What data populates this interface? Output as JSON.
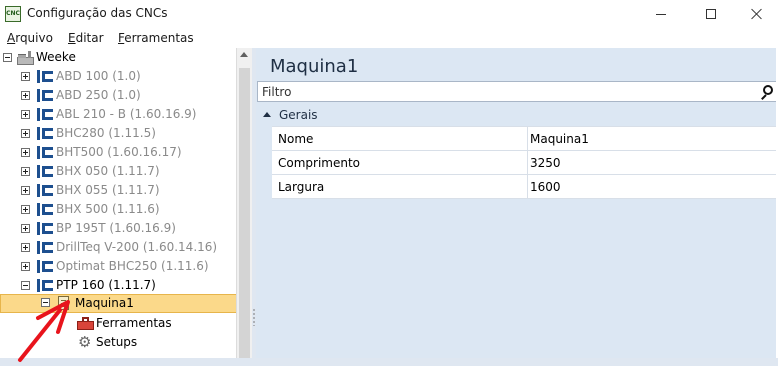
{
  "window": {
    "title": "Configuração das CNCs",
    "app_icon_text": "CNC"
  },
  "menu": {
    "items": [
      "Arquivo",
      "Editar",
      "Ferramentas"
    ]
  },
  "tree": {
    "root": {
      "label": "Weeke",
      "icon": "factory-icon",
      "expanded": true
    },
    "machines": [
      {
        "label": "ABD 100 (1.0)",
        "expanded": false,
        "disabled": true
      },
      {
        "label": "ABD 250 (1.0)",
        "expanded": false,
        "disabled": true
      },
      {
        "label": "ABL 210 - B (1.60.16.9)",
        "expanded": false,
        "disabled": true
      },
      {
        "label": "BHC280 (1.11.5)",
        "expanded": false,
        "disabled": true
      },
      {
        "label": "BHT500 (1.60.16.17)",
        "expanded": false,
        "disabled": true
      },
      {
        "label": "BHX 050 (1.11.7)",
        "expanded": false,
        "disabled": true
      },
      {
        "label": "BHX 055 (1.11.7)",
        "expanded": false,
        "disabled": true
      },
      {
        "label": "BHX 500 (1.11.6)",
        "expanded": false,
        "disabled": true
      },
      {
        "label": "BP 195T (1.60.16.9)",
        "expanded": false,
        "disabled": true
      },
      {
        "label": "DrillTeq V-200 (1.60.14.16)",
        "expanded": false,
        "disabled": true
      },
      {
        "label": "Optimat BHC250 (1.11.6)",
        "expanded": false,
        "disabled": true
      },
      {
        "label": "PTP 160 (1.11.7)",
        "expanded": true,
        "disabled": false
      }
    ],
    "selected": {
      "label": "Maquina1",
      "expanded": true
    },
    "children": [
      {
        "label": "Ferramentas",
        "icon": "toolbox-icon"
      },
      {
        "label": "Setups",
        "icon": "gear-icon"
      }
    ]
  },
  "properties": {
    "title": "Maquina1",
    "filter_placeholder": "Filtro",
    "group": "Gerais",
    "rows": [
      {
        "name": "Nome",
        "value": "Maquina1"
      },
      {
        "name": "Comprimento",
        "value": "3250"
      },
      {
        "name": "Largura",
        "value": "1600"
      }
    ]
  },
  "colors": {
    "selection_fill": "#fbd98a",
    "selection_border": "#e7b54b",
    "panel_background": "#dce7f3",
    "disabled_text": "#8a8a8a",
    "annotation_arrow": "#e8141c"
  }
}
